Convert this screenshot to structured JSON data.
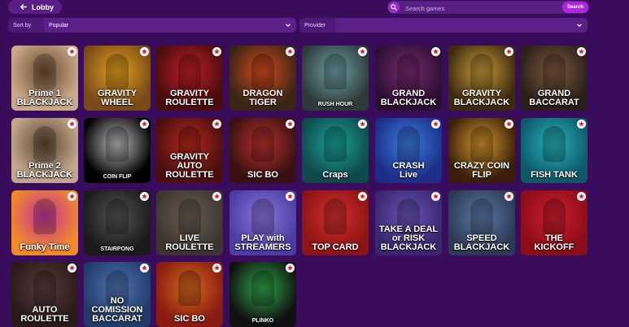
{
  "header": {
    "lobby_label": "Lobby",
    "search_placeholder": "Search games",
    "search_button": "Search"
  },
  "filters": {
    "sort_label": "Sort by",
    "sort_value": "Popular",
    "provider_label": "Provider",
    "provider_value": ""
  },
  "games": [
    {
      "title": "Prime 1\nBLACKJACK",
      "bg": "#c9a98a",
      "accent": "#6b4a2e",
      "size": "big"
    },
    {
      "title": "GRAVITY\nWHEEL",
      "bg": "#7a4b18",
      "accent": "#e5a21e",
      "size": "big"
    },
    {
      "title": "GRAVITY\nROULETTE",
      "bg": "#4a0d0d",
      "accent": "#c21f2a",
      "size": "big"
    },
    {
      "title": "DRAGON\nTIGER",
      "bg": "#3b2615",
      "accent": "#d74a1d",
      "size": "big"
    },
    {
      "title": "RUSH HOUR",
      "bg": "#2f3a3a",
      "accent": "#6fa1a8",
      "size": "small"
    },
    {
      "title": "GRAND\nBLACKJACK",
      "bg": "#2b1033",
      "accent": "#7a2a6e",
      "size": "big"
    },
    {
      "title": "GRAVITY\nBLACKJACK",
      "bg": "#3e2a0f",
      "accent": "#c89b3a",
      "size": "big"
    },
    {
      "title": "GRAND\nBACCARAT",
      "bg": "#2a1f1a",
      "accent": "#7e5a3e",
      "size": "big"
    },
    {
      "title": "Prime 2\nBLACKJACK",
      "bg": "#c4a88d",
      "accent": "#5a4330",
      "size": "big"
    },
    {
      "title": "COIN FLIP",
      "bg": "#000000",
      "accent": "#bdbdbd",
      "size": "small"
    },
    {
      "title": "GRAVITY\nAUTO ROULETTE",
      "bg": "#4c0f0e",
      "accent": "#b4281d",
      "size": "big"
    },
    {
      "title": "SIC BO",
      "bg": "#3a1012",
      "accent": "#b8322c",
      "size": "big"
    },
    {
      "title": "Craps",
      "bg": "#0e4a4a",
      "accent": "#1aa39a",
      "size": "big"
    },
    {
      "title": "CRASH\nLive",
      "bg": "#1b2f8a",
      "accent": "#3d7de0",
      "size": "big"
    },
    {
      "title": "CRAZY COIN FLIP",
      "bg": "#3b1f0b",
      "accent": "#d5972a",
      "size": "big"
    },
    {
      "title": "FISH TANK",
      "bg": "#0d5a6b",
      "accent": "#27b3b8",
      "size": "big"
    },
    {
      "title": "Funky Time",
      "bg": "#f08a2a",
      "accent": "#c2309e",
      "size": "big"
    },
    {
      "title": "STAIRPONG",
      "bg": "#1a1a1a",
      "accent": "#555555",
      "size": "small"
    },
    {
      "title": "LIVE\nROULETTE",
      "bg": "#3d3630",
      "accent": "#6b5d50",
      "size": "big"
    },
    {
      "title": "PLAY with\nSTREAMERS",
      "bg": "#4a3ea5",
      "accent": "#8e75d8",
      "size": "big"
    },
    {
      "title": "TOP CARD",
      "bg": "#8d1414",
      "accent": "#d33030",
      "size": "big"
    },
    {
      "title": "TAKE A DEAL or RISK\nBLACKJACK",
      "bg": "#3a2770",
      "accent": "#6a52b5",
      "size": "big"
    },
    {
      "title": "SPEED\nBLACKJACK",
      "bg": "#2d3a55",
      "accent": "#5c7aa8",
      "size": "big"
    },
    {
      "title": "THE\nKICKOFF",
      "bg": "#8a0d18",
      "accent": "#d11e2e",
      "size": "big"
    },
    {
      "title": "AUTO\nROULETTE",
      "bg": "#2a1a1a",
      "accent": "#5b3b3b",
      "size": "big"
    },
    {
      "title": "NO COMISSION\nBACCARAT",
      "bg": "#223c6a",
      "accent": "#4f73b3",
      "size": "big"
    },
    {
      "title": "SIC BO",
      "bg": "#8a1b10",
      "accent": "#d2681f",
      "size": "big"
    },
    {
      "title": "PLINKO",
      "bg": "#111111",
      "accent": "#2ea84c",
      "size": "small"
    }
  ]
}
